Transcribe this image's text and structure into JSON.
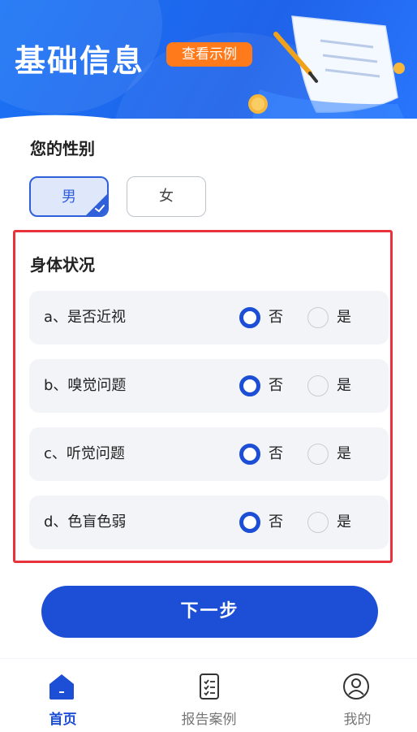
{
  "header": {
    "title": "基础信息",
    "example_button": "查看示例"
  },
  "gender": {
    "label": "您的性别",
    "options": [
      "男",
      "女"
    ],
    "selected": "男"
  },
  "body_status": {
    "title": "身体状况",
    "items": [
      {
        "label": "a、是否近视",
        "no": "否",
        "yes": "是",
        "selected": "否"
      },
      {
        "label": "b、嗅觉问题",
        "no": "否",
        "yes": "是",
        "selected": "否"
      },
      {
        "label": "c、听觉问题",
        "no": "否",
        "yes": "是",
        "selected": "否"
      },
      {
        "label": "d、色盲色弱",
        "no": "否",
        "yes": "是",
        "selected": "否"
      }
    ]
  },
  "next_button": "下一步",
  "tabbar": {
    "tabs": [
      {
        "label": "首页",
        "icon": "home-icon",
        "active": true
      },
      {
        "label": "报告案例",
        "icon": "report-list-icon",
        "active": false
      },
      {
        "label": "我的",
        "icon": "user-icon",
        "active": false
      }
    ]
  },
  "colors": {
    "primary": "#1d4fd6",
    "accent_orange": "#ff7a1a",
    "highlight_frame": "#e8333c"
  }
}
